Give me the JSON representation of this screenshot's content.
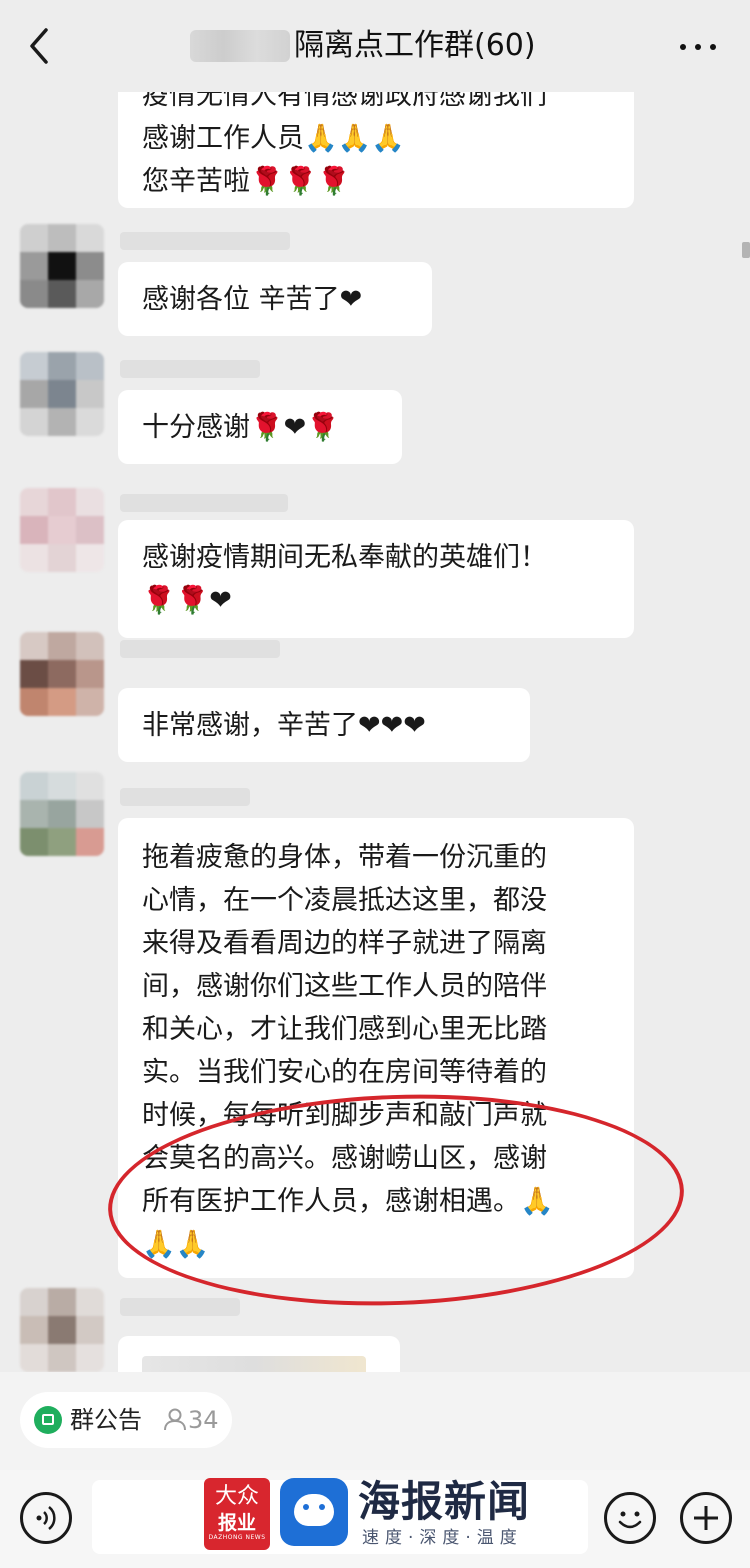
{
  "header": {
    "title": "隔离点工作群(60)"
  },
  "messages": [
    {
      "lines": [
        "疫情无情人有情感谢政府感谢我们",
        "感谢工作人员🙏🙏🙏",
        "您辛苦啦🌹🌹🌹"
      ]
    },
    {
      "lines": [
        "感谢各位 辛苦了❤"
      ]
    },
    {
      "lines": [
        "十分感谢🌹❤🌹"
      ]
    },
    {
      "lines": [
        "感谢疫情期间无私奉献的英雄们！",
        "🌹🌹❤"
      ]
    },
    {
      "lines": [
        "非常感谢，辛苦了❤❤❤"
      ]
    },
    {
      "lines": [
        "拖着疲惫的身体，带着一份沉重的",
        "心情，在一个凌晨抵达这里，都没",
        "来得及看看周边的样子就进了隔离",
        "间，感谢你们这些工作人员的陪伴",
        "和关心，才让我们感到心里无比踏",
        "实。当我们安心的在房间等待着的",
        "时候，每每听到脚步声和敲门声就",
        "会莫名的高兴。感谢崂山区，感谢",
        "所有医护工作人员，感谢相遇。🙏",
        "🙏🙏"
      ]
    }
  ],
  "notice_bar": {
    "label": "群公告",
    "member_count": "34"
  },
  "watermark": {
    "dazhong_top": "大众",
    "dazhong_bottom": "报业",
    "dazhong_en": "DAZHONG NEWS",
    "haibao_name": "海报新闻",
    "haibao_slogan": "速度·深度·温度"
  },
  "icons": {
    "back": "chevron-left-icon",
    "more": "more-dots-icon",
    "voice": "voice-icon",
    "emoji": "emoji-icon",
    "plus": "plus-icon"
  },
  "colors": {
    "background": "#ededed",
    "bubble": "#ffffff",
    "highlight_circle": "#d5262c",
    "notice_green": "#1fae5d"
  }
}
